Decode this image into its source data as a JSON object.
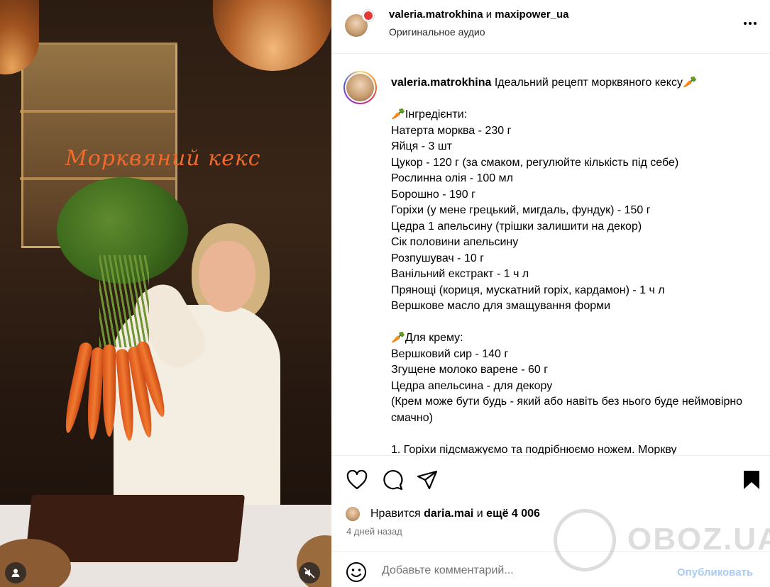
{
  "media": {
    "overlay_title": "Морквяний кекс",
    "icons": {
      "tagged_users": "user-icon",
      "mute": "speaker-muted-icon"
    }
  },
  "header": {
    "author": "valeria.matrokhina",
    "conjunction": "и",
    "collaborator": "maxipower_ua",
    "audio": "Оригинальное аудио",
    "more_icon": "more-horizontal-icon"
  },
  "caption": {
    "author": "valeria.matrokhina",
    "title": "Ідеальний рецепт морквяного кексу🥕",
    "ingredients_heading": "🥕Інгредієнти:",
    "ingredients": [
      "Натерта морква - 230 г",
      "Яйця - 3 шт",
      "Цукор - 120 г (за смаком, регулюйте кількість під себе)",
      "Рослинна олія - 100 мл",
      "Борошно - 190 г",
      "Горіхи (у мене грецький, мигдаль, фундук) - 150 г",
      "Цедра 1 апельсину (трішки залишити на декор)",
      "Сік половини апельсину",
      "Розпушувач - 10 г",
      "Ванільний екстракт - 1 ч л",
      "Прянощі (кориця, мускатний горіх, кардамон) - 1 ч л",
      "Вершкове масло для змащування форми"
    ],
    "cream_heading": "🥕Для крему:",
    "cream": [
      "Вершковий сир - 140 г",
      "Згущене молоко варене - 60 г",
      "Цедра апельсина - для декору",
      "(Крем може бути будь - який або навіть без нього буде неймовірно смачно)"
    ],
    "step1": "1. Горіхи підсмажуємо та подрібнюємо ножем. Моркву"
  },
  "actions": {
    "like_icon": "heart-icon",
    "comment_icon": "comment-icon",
    "share_icon": "send-icon",
    "save_icon": "bookmark-icon"
  },
  "likes": {
    "prefix": "Нравится",
    "user": "daria.mai",
    "conjunction": "и",
    "others": "ещё 4 006"
  },
  "time": "4 дней назад",
  "comment": {
    "placeholder": "Добавьте комментарий...",
    "publish_label": "Опубликовать",
    "emoji_icon": "smiley-icon"
  },
  "watermark": "OBOZ.UA",
  "colors": {
    "overlay_title": "#ef6a2c",
    "publish_disabled": "#a9ccf4",
    "secondary_text": "#737373"
  }
}
